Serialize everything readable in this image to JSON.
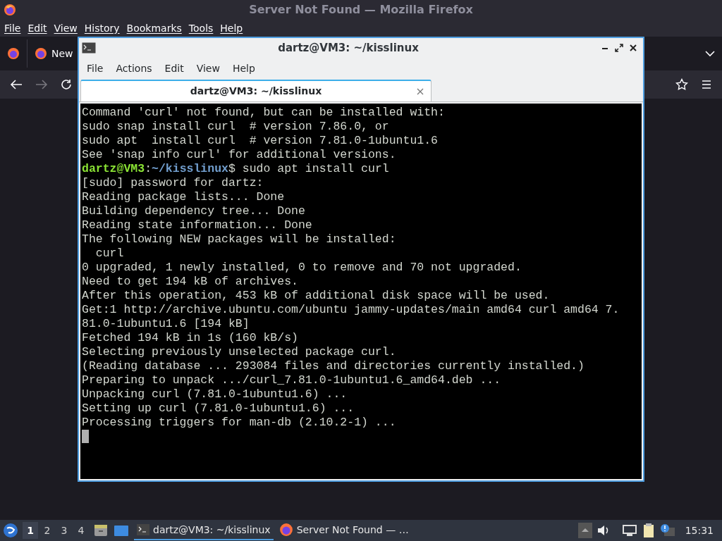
{
  "browser": {
    "title": "Server Not Found — Mozilla Firefox",
    "menu": [
      "File",
      "Edit",
      "View",
      "History",
      "Bookmarks",
      "Tools",
      "Help"
    ],
    "tabs": [
      {
        "label": "New"
      }
    ]
  },
  "terminal": {
    "title": "dartz@VM3: ~/kisslinux",
    "menu": [
      "File",
      "Actions",
      "Edit",
      "View",
      "Help"
    ],
    "tab": {
      "label": "dartz@VM3: ~/kisslinux",
      "selected": true
    },
    "lines": [
      [
        {
          "kind": "plain",
          "text": "Command 'curl' not found, but can be installed with:"
        }
      ],
      [
        {
          "kind": "plain",
          "text": "sudo snap install curl  # version 7.86.0, or"
        }
      ],
      [
        {
          "kind": "plain",
          "text": "sudo apt  install curl  # version 7.81.0-1ubuntu1.6"
        }
      ],
      [
        {
          "kind": "plain",
          "text": "See 'snap info curl' for additional versions."
        }
      ],
      [
        {
          "kind": "user",
          "text": "dartz@VM3"
        },
        {
          "kind": "plain",
          "text": ":"
        },
        {
          "kind": "path",
          "text": "~/kisslinux"
        },
        {
          "kind": "plain",
          "text": "$ sudo apt install curl"
        }
      ],
      [
        {
          "kind": "plain",
          "text": "[sudo] password for dartz:"
        }
      ],
      [
        {
          "kind": "plain",
          "text": "Reading package lists... Done"
        }
      ],
      [
        {
          "kind": "plain",
          "text": "Building dependency tree... Done"
        }
      ],
      [
        {
          "kind": "plain",
          "text": "Reading state information... Done"
        }
      ],
      [
        {
          "kind": "plain",
          "text": "The following NEW packages will be installed:"
        }
      ],
      [
        {
          "kind": "plain",
          "text": "  curl"
        }
      ],
      [
        {
          "kind": "plain",
          "text": "0 upgraded, 1 newly installed, 0 to remove and 70 not upgraded."
        }
      ],
      [
        {
          "kind": "plain",
          "text": "Need to get 194 kB of archives."
        }
      ],
      [
        {
          "kind": "plain",
          "text": "After this operation, 453 kB of additional disk space will be used."
        }
      ],
      [
        {
          "kind": "plain",
          "text": "Get:1 http://archive.ubuntu.com/ubuntu jammy-updates/main amd64 curl amd64 7."
        }
      ],
      [
        {
          "kind": "plain",
          "text": "81.0-1ubuntu1.6 [194 kB]"
        }
      ],
      [
        {
          "kind": "plain",
          "text": "Fetched 194 kB in 1s (160 kB/s)"
        }
      ],
      [
        {
          "kind": "plain",
          "text": "Selecting previously unselected package curl."
        }
      ],
      [
        {
          "kind": "plain",
          "text": "(Reading database ... 293084 files and directories currently installed.)"
        }
      ],
      [
        {
          "kind": "plain",
          "text": "Preparing to unpack .../curl_7.81.0-1ubuntu1.6_amd64.deb ..."
        }
      ],
      [
        {
          "kind": "plain",
          "text": "Unpacking curl (7.81.0-1ubuntu1.6) ..."
        }
      ],
      [
        {
          "kind": "plain",
          "text": "Setting up curl (7.81.0-1ubuntu1.6) ..."
        }
      ],
      [
        {
          "kind": "plain",
          "text": "Processing triggers for man-db (2.10.2-1) ..."
        }
      ]
    ],
    "cursor": true
  },
  "taskbar": {
    "workspaces": [
      {
        "label": "1",
        "selected": true
      },
      {
        "label": "2",
        "selected": false
      },
      {
        "label": "3",
        "selected": false
      },
      {
        "label": "4",
        "selected": false
      }
    ],
    "tasks": [
      {
        "label": "dartz@VM3: ~/kisslinux",
        "kind": "terminal",
        "selected": true
      },
      {
        "label": "Server Not Found — …",
        "kind": "browser",
        "selected": false
      }
    ],
    "clock": "15:31"
  }
}
